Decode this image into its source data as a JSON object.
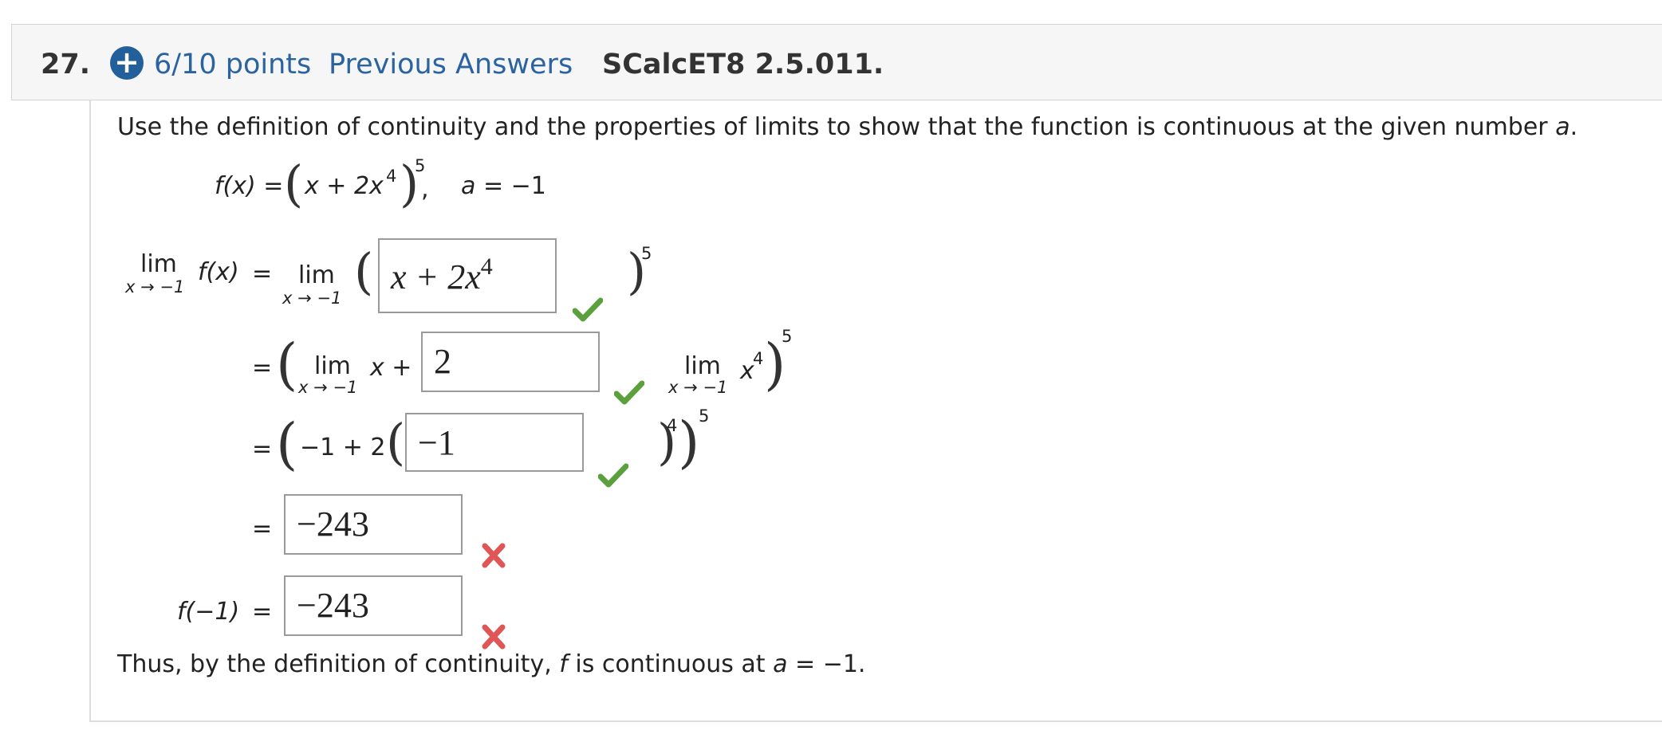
{
  "header": {
    "question_number": "27.",
    "points": "6/10 points",
    "previous_answers": "Previous Answers",
    "problem_id": "SCalcET8 2.5.011."
  },
  "instruction": {
    "before": "Use the definition of continuity and the properties of limits to show that the function is continuous at the given number ",
    "var": "a",
    "after": "."
  },
  "function_def": {
    "f_lhs": "f(x) =",
    "inner": "x + 2x",
    "inner_exp": "4",
    "outer_exp": "5",
    "comma": ",",
    "a_var": "a",
    "a_val": "= −1"
  },
  "limit_steps": {
    "lim": "lim",
    "sub": "x → −1",
    "fx": "f(x)",
    "eq": "=",
    "exp5": "5",
    "exp4": "4",
    "row2_x": "x +",
    "row2_x4": "x",
    "row3_text": "−1 + 2",
    "f_minus1": "f(−1)"
  },
  "answers": {
    "box1_main": "x + 2x",
    "box1_exp": "4",
    "box2": "2",
    "box3": "−1",
    "box4": "−243",
    "box5": "−243"
  },
  "conclusion": {
    "before": "Thus, by the definition of continuity, ",
    "f": "f",
    "middle": " is continuous at ",
    "a": "a",
    "after": " = −1."
  },
  "colors": {
    "link_blue": "#2a63a0",
    "badge_blue": "#23609b",
    "correct_green": "#5aa03c",
    "incorrect_red": "#e05555"
  }
}
